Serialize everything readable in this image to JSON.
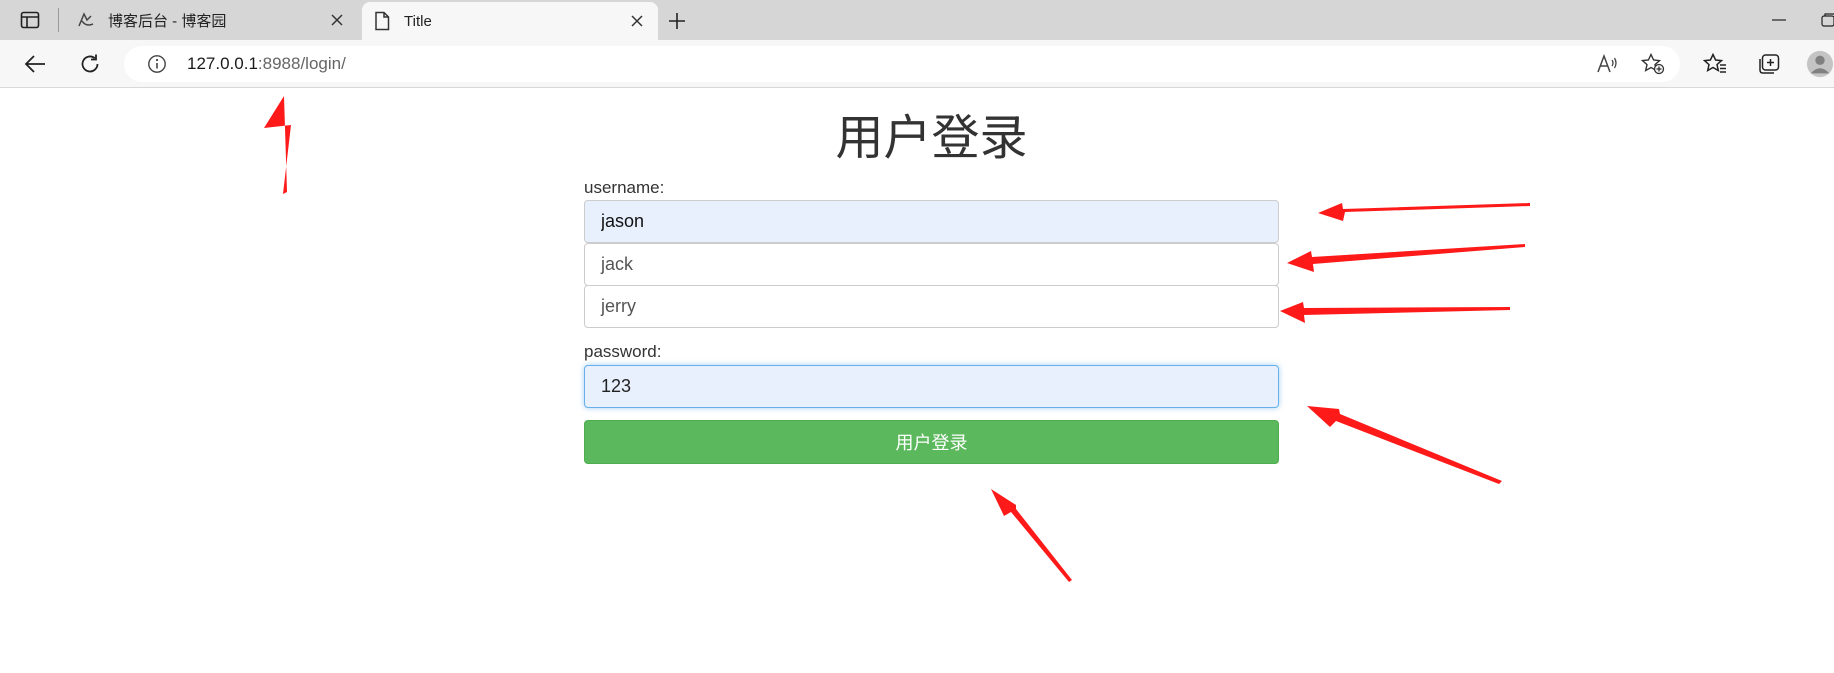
{
  "browser": {
    "tabs": [
      {
        "title": "博客后台 - 博客园",
        "active": false,
        "favicon": "cnblogs-icon"
      },
      {
        "title": "Title",
        "active": true,
        "favicon": "page-icon"
      }
    ],
    "address": {
      "host": "127.0.0.1",
      "path": ":8988/login/"
    }
  },
  "page": {
    "title": "用户登录",
    "username_label": "username:",
    "username_options": [
      "jason",
      "jack",
      "jerry"
    ],
    "password_label": "password:",
    "password_value": "123",
    "submit_label": "用户登录"
  },
  "colors": {
    "submit_button": "#5cb85c",
    "autofill_background": "#e8f0fe",
    "annotation_arrow": "#ff1a1a"
  }
}
